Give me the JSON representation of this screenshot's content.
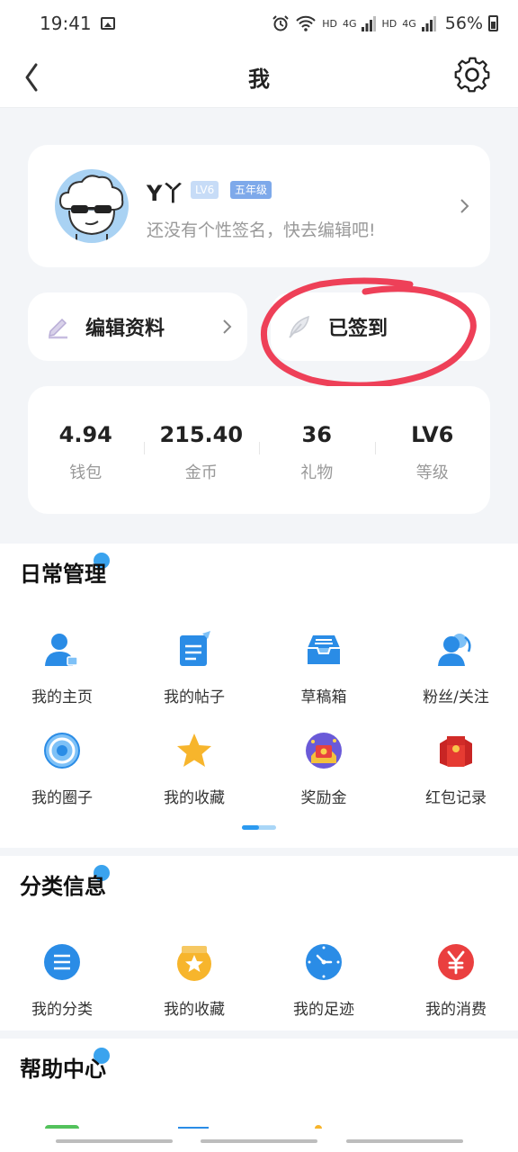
{
  "status_bar": {
    "time": "19:41",
    "battery": "56%",
    "net_labels": [
      "HD",
      "4G",
      "HD",
      "4G"
    ],
    "icons": [
      "image-icon",
      "alarm-icon",
      "wifi-icon",
      "signal-icon",
      "battery-icon"
    ]
  },
  "nav": {
    "title": "我",
    "back_icon": "back-icon",
    "settings_icon": "gear-icon"
  },
  "profile": {
    "name": "Y丫",
    "level_badge": "LV6",
    "grade_badge": "五年级",
    "signature": "还没有个性签名，快去编辑吧!"
  },
  "actions": {
    "edit_profile": "编辑资料",
    "signed_in": "已签到"
  },
  "stats": [
    {
      "value": "4.94",
      "label": "钱包"
    },
    {
      "value": "215.40",
      "label": "金币"
    },
    {
      "value": "36",
      "label": "礼物"
    },
    {
      "value": "LV6",
      "label": "等级"
    }
  ],
  "daily": {
    "title": "日常管理",
    "items": [
      {
        "label": "我的主页",
        "icon": "user-home-icon"
      },
      {
        "label": "我的帖子",
        "icon": "post-icon"
      },
      {
        "label": "草稿箱",
        "icon": "drafts-icon"
      },
      {
        "label": "粉丝/关注",
        "icon": "fans-icon"
      },
      {
        "label": "我的圈子",
        "icon": "circle-icon"
      },
      {
        "label": "我的收藏",
        "icon": "star-icon"
      },
      {
        "label": "奖励金",
        "icon": "reward-icon"
      },
      {
        "label": "红包记录",
        "icon": "red-packet-icon"
      }
    ]
  },
  "category": {
    "title": "分类信息",
    "items": [
      {
        "label": "我的分类",
        "icon": "list-icon"
      },
      {
        "label": "我的收藏",
        "icon": "favorite-box-icon"
      },
      {
        "label": "我的足迹",
        "icon": "clock-icon"
      },
      {
        "label": "我的消费",
        "icon": "yen-icon"
      }
    ]
  },
  "help": {
    "title": "帮助中心"
  },
  "colors": {
    "accent": "#2b9af0",
    "annotation": "#ee4058",
    "background": "#f3f5f8"
  }
}
